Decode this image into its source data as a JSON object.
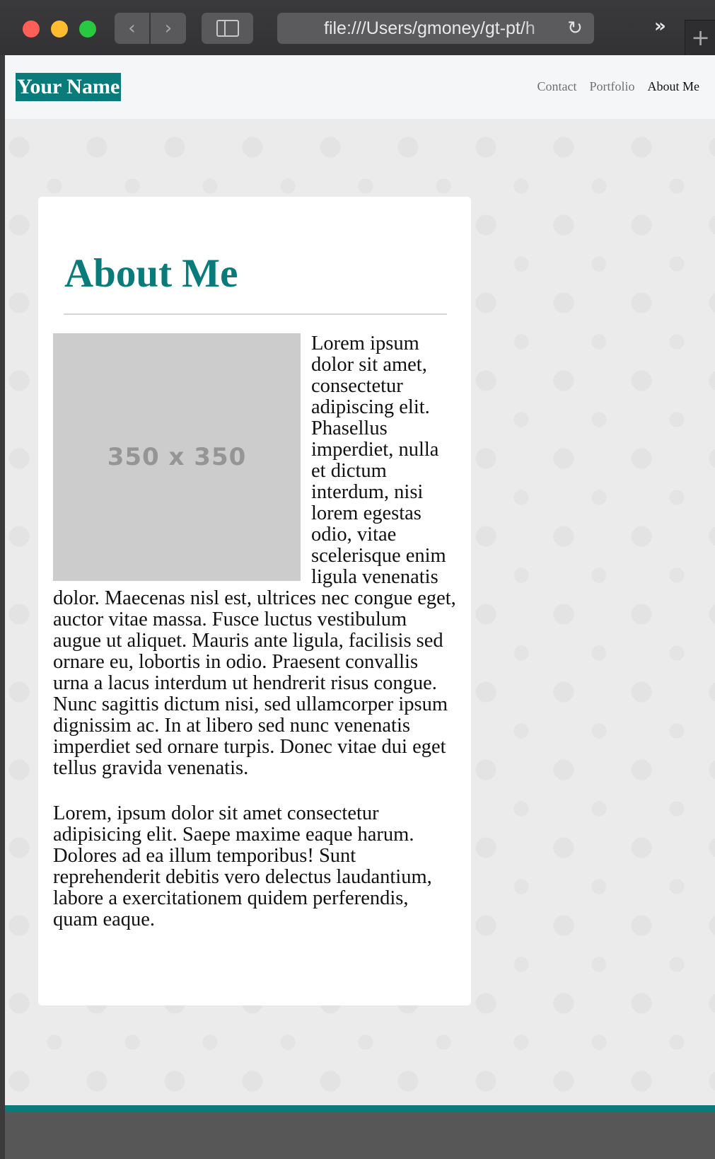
{
  "browser": {
    "url": "file:///Users/gmoney/gt-pt/h",
    "back_icon": "‹",
    "forward_icon": "›",
    "reload_icon": "↻",
    "overflow_icon": "»",
    "newtab_icon": "+"
  },
  "colors": {
    "accent": "#0a7b7b",
    "footer": "#575757"
  },
  "header": {
    "logo": "Your Name",
    "nav": [
      "Contact",
      "Portfolio",
      "About Me"
    ],
    "active_nav": "About Me"
  },
  "main": {
    "title": "About Me",
    "image_placeholder": "350 x 350",
    "paragraph_1": "Lorem ipsum dolor sit amet, consectetur adipiscing elit. Phasellus imperdiet, nulla et dictum interdum, nisi lorem egestas odio, vitae scelerisque enim ligula venenatis dolor. Maecenas nisl est, ultrices nec congue eget, auctor vitae massa. Fusce luctus vestibulum augue ut aliquet. Mauris ante ligula, facilisis sed ornare eu, lobortis in odio. Praesent convallis urna a lacus interdum ut hendrerit risus congue. Nunc sagittis dictum nisi, sed ullamcorper ipsum dignissim ac. In at libero sed nunc venenatis imperdiet sed ornare turpis. Donec vitae dui eget tellus gravida venenatis.",
    "paragraph_2": "Lorem, ipsum dolor sit amet consectetur adipisicing elit. Saepe maxime eaque harum. Dolores ad ea illum temporibus! Sunt reprehenderit debitis vero delectus laudantium, labore a exercitationem quidem perferendis, quam eaque."
  }
}
